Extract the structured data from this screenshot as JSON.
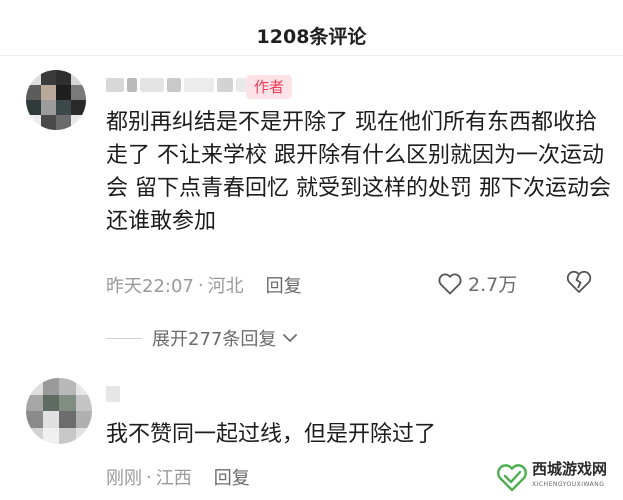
{
  "header": {
    "title": "1208条评论"
  },
  "comments": [
    {
      "author_badge": "作者",
      "text": "都别再纠结是不是开除了 现在他们所有东西都收拾走了 不让来学校 跟开除有什么区别就因为一次运动会 留下点青春回忆 就受到这样的处罚 那下次运动会还谁敢参加",
      "time": "昨天22:07",
      "separator": "·",
      "location": "河北",
      "reply_label": "回复",
      "likes": "2.7万",
      "expand_label": "展开277条回复"
    },
    {
      "text": "我不赞同一起过线，但是开除过了",
      "time": "刚刚",
      "separator": "·",
      "location": "江西",
      "reply_label": "回复"
    }
  ],
  "watermark": {
    "text": "西城游戏网",
    "sub": "XICHENGYOUXIWANG"
  },
  "colors": {
    "accent": "#f23c5a",
    "badge_bg": "#fde3e7",
    "meta_gray": "#9a9a9a",
    "text": "#1c1c1c",
    "watermark_green": "#4caf50"
  }
}
